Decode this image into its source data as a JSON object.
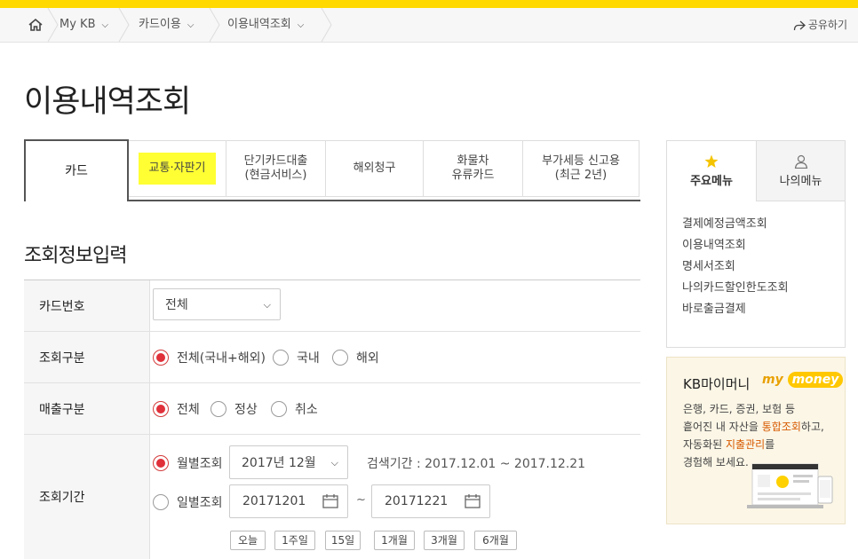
{
  "breadcrumb": {
    "items": [
      {
        "label": "My KB"
      },
      {
        "label": "카드이용"
      },
      {
        "label": "이용내역조회"
      }
    ],
    "share_label": "공유하기"
  },
  "page": {
    "title": "이용내역조회"
  },
  "tabs": [
    {
      "line1": "카드",
      "line2": ""
    },
    {
      "line1": "교통·자판기",
      "line2": ""
    },
    {
      "line1": "단기카드대출",
      "line2": "(현금서비스)"
    },
    {
      "line1": "해외청구",
      "line2": ""
    },
    {
      "line1": "화물차",
      "line2": "유류카드"
    },
    {
      "line1": "부가세등 신고용",
      "line2": "(최근 2년)"
    }
  ],
  "form": {
    "section_title": "조회정보입력",
    "card_number": {
      "label": "카드번호",
      "selected": "전체"
    },
    "inquiry_type": {
      "label": "조회구분",
      "options": [
        "전체(국내+해외)",
        "국내",
        "해외"
      ]
    },
    "sales_type": {
      "label": "매출구분",
      "options": [
        "전체",
        "정상",
        "취소"
      ]
    },
    "period": {
      "label": "조회기간",
      "monthly_label": "월별조회",
      "monthly_selected": "2017년 12월",
      "search_range": "검색기간 : 2017.12.01 ~ 2017.12.21",
      "daily_label": "일별조회",
      "start_date": "20171201",
      "tilde": "~",
      "end_date": "20171221",
      "quick_buttons": [
        "오늘",
        "1주일",
        "15일",
        "1개월",
        "3개월",
        "6개월"
      ]
    }
  },
  "side_menu": {
    "tab_main": "주요메뉴",
    "tab_mine": "나의메뉴",
    "items": [
      "결제예정금액조회",
      "이용내역조회",
      "명세서조회",
      "나의카드할인한도조회",
      "바로출금결제"
    ]
  },
  "banner": {
    "title": "KB마이머니",
    "brand_my": "my",
    "brand_money": "money",
    "line1": "은행, 카드, 증권, 보험 등",
    "line2_a": "흩어진 내 자산을 ",
    "line2_em": "통합조회",
    "line2_b": "하고,",
    "line3_a": "자동화된 ",
    "line3_em": "지출관리",
    "line3_b": "를",
    "line4": "경험해 보세요."
  },
  "colors": {
    "accent": "#ffd900",
    "radio_on": "#e0303a",
    "highlight": "#ffff33"
  }
}
